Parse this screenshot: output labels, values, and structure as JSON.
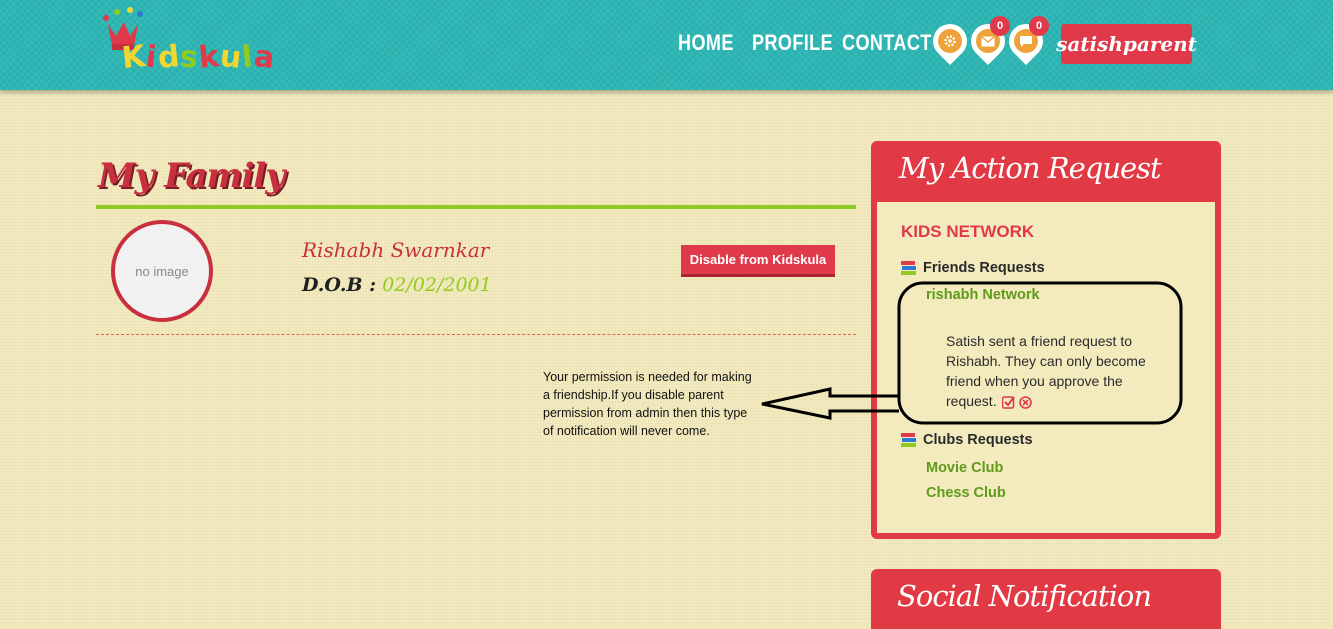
{
  "brand": {
    "logo_letters": [
      "K",
      "i",
      "d",
      "s",
      "k",
      "u",
      "l",
      "a"
    ],
    "logo_colors": [
      "#f4d630",
      "#e0394a",
      "#f4d630",
      "#8fcc1f",
      "#e0394a",
      "#f4d630",
      "#8fcc1f",
      "#e0394a"
    ]
  },
  "nav": {
    "items": [
      "HOME",
      "PROFILE",
      "CONTACT"
    ],
    "settings_icon": "gear-icon",
    "mail_icon": "envelope-icon",
    "mail_count": "0",
    "chat_icon": "chat-bubble-icon",
    "chat_count": "0",
    "user_name": "satishparent"
  },
  "family": {
    "title": "My Family",
    "avatar_placeholder": "no image",
    "child_name": "Rishabh Swarnkar",
    "dob_label": "D.O.B :",
    "dob_value": "02/02/2001",
    "disable_button": "Disable from Kidskula"
  },
  "annotation": {
    "note": "Your permission is needed for making a friendship.If you disable parent permission from admin then this type of notification will never come."
  },
  "action_request": {
    "title": "My Action Request",
    "section": "KIDS NETWORK",
    "friends_heading": "Friends Requests",
    "friend_network": "rishabh Network",
    "request_text": "Satish sent a friend request to Rishabh. They can only become friend when you approve the request.",
    "clubs_heading": "Clubs Requests",
    "clubs": [
      "Movie Club",
      "Chess Club"
    ]
  },
  "social": {
    "title": "Social Notification"
  },
  "colors": {
    "header_teal": "#2cb6b4",
    "accent_red": "#e0394a",
    "accent_green": "#8fcc1f",
    "page_bg": "#f3ebbe",
    "icon_orange": "#f0a23a"
  }
}
